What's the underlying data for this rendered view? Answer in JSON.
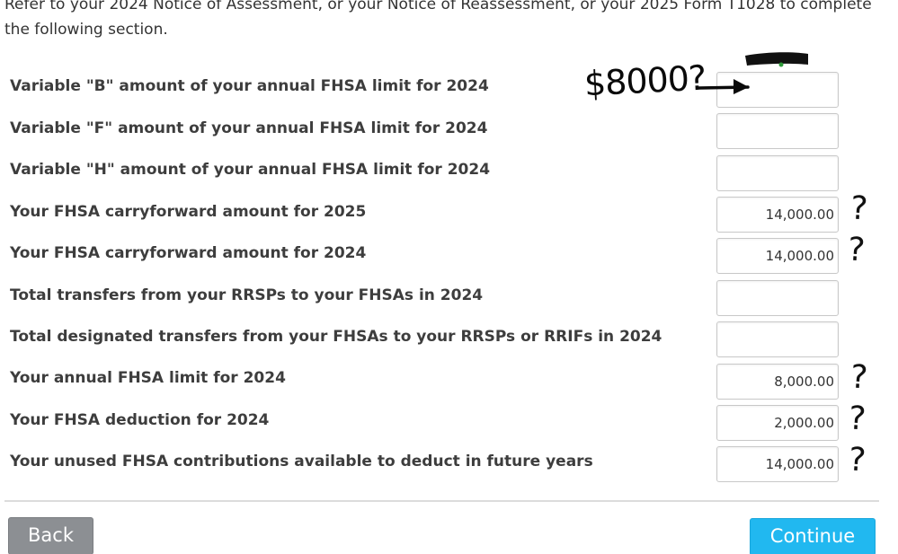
{
  "intro": {
    "text": "Refer to your 2024 Notice of Assessment, or your Notice of Reassessment, or your 2025 Form T1028 to complete the following section."
  },
  "rows": [
    {
      "label": "Variable \"B\" amount of your annual FHSA limit for 2024",
      "value": ""
    },
    {
      "label": "Variable \"F\" amount of your annual FHSA limit for 2024",
      "value": ""
    },
    {
      "label": "Variable \"H\" amount of your annual FHSA limit for 2024",
      "value": ""
    },
    {
      "label": "Your FHSA carryforward amount for 2025",
      "value": "14,000.00"
    },
    {
      "label": "Your FHSA carryforward amount for 2024",
      "value": "14,000.00"
    },
    {
      "label": "Total transfers from your RRSPs to your FHSAs in 2024",
      "value": ""
    },
    {
      "label": "Total designated transfers from your FHSAs to your RRSPs or RRIFs in 2024",
      "value": ""
    },
    {
      "label": "Your annual FHSA limit for 2024",
      "value": "8,000.00"
    },
    {
      "label": "Your FHSA deduction for 2024",
      "value": "2,000.00"
    },
    {
      "label": "Your unused FHSA contributions available to deduct in future years",
      "value": "14,000.00"
    }
  ],
  "annotations": {
    "handwritten_note": "$8000?",
    "question_mark": "?"
  },
  "buttons": {
    "back_label": "Back",
    "continue_label": "Continue"
  },
  "colors": {
    "continue_button": "#21b8f0",
    "back_button": "#8c8f93"
  }
}
